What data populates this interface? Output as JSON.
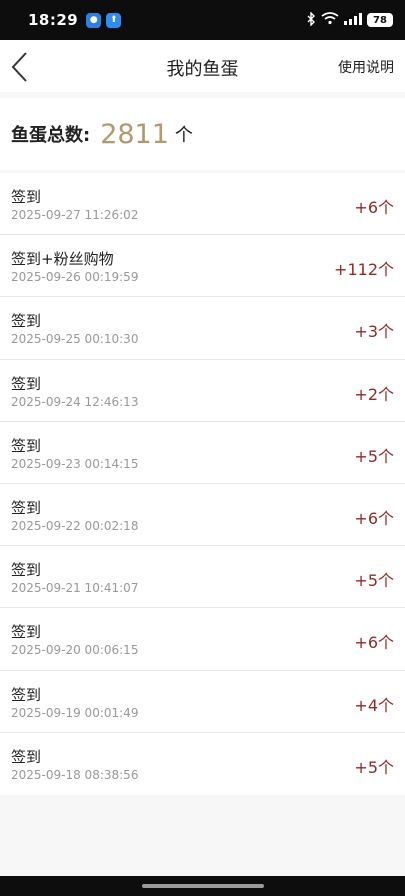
{
  "status_bar": {
    "time": "18:29",
    "battery": "78"
  },
  "header": {
    "title": "我的鱼蛋",
    "help_label": "使用说明"
  },
  "summary": {
    "label": "鱼蛋总数:",
    "value": "2811",
    "unit": "个"
  },
  "records": [
    {
      "title": "签到",
      "time": "2025-09-27 11:26:02",
      "amount": "+6个"
    },
    {
      "title": "签到+粉丝购物",
      "time": "2025-09-26 00:19:59",
      "amount": "+112个"
    },
    {
      "title": "签到",
      "time": "2025-09-25 00:10:30",
      "amount": "+3个"
    },
    {
      "title": "签到",
      "time": "2025-09-24 12:46:13",
      "amount": "+2个"
    },
    {
      "title": "签到",
      "time": "2025-09-23 00:14:15",
      "amount": "+5个"
    },
    {
      "title": "签到",
      "time": "2025-09-22 00:02:18",
      "amount": "+6个"
    },
    {
      "title": "签到",
      "time": "2025-09-21 10:41:07",
      "amount": "+5个"
    },
    {
      "title": "签到",
      "time": "2025-09-20 00:06:15",
      "amount": "+6个"
    },
    {
      "title": "签到",
      "time": "2025-09-19 00:01:49",
      "amount": "+4个"
    },
    {
      "title": "签到",
      "time": "2025-09-18 08:38:56",
      "amount": "+5个"
    }
  ],
  "colors": {
    "accent_gold": "#b09a6e",
    "amount_red": "#8f2a2a"
  }
}
